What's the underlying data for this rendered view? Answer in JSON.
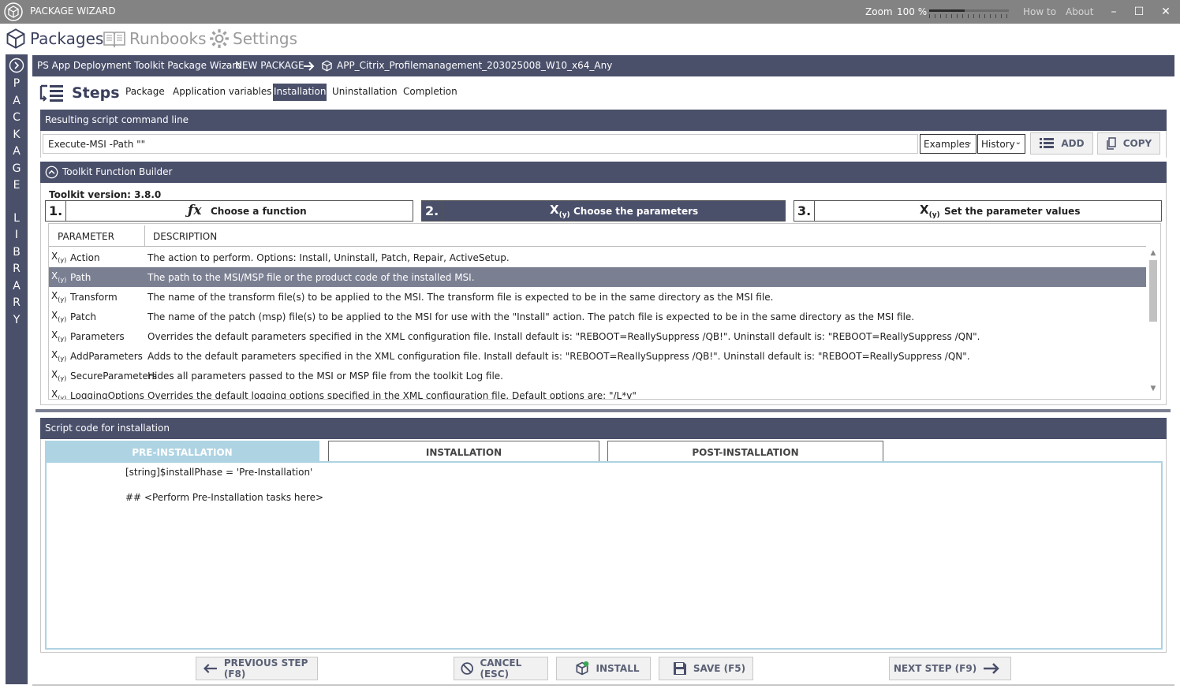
{
  "window": {
    "title": "PACKAGE WIZARD",
    "zoom_label": "Zoom",
    "zoom_value": "100 %",
    "zoom_fraction": 0.45,
    "how_to": "How to",
    "about": "About",
    "minimize": "–",
    "maximize": "☐",
    "close": "✕"
  },
  "nav": {
    "packages": "Packages",
    "runbooks": "Runbooks",
    "settings": "Settings"
  },
  "sidebar": {
    "letters": [
      "P",
      "A",
      "C",
      "K",
      "A",
      "G",
      "E",
      "L",
      "I",
      "B",
      "R",
      "A",
      "R",
      "Y"
    ]
  },
  "header": {
    "wizard_title": "PS App Deployment Toolkit Package Wizard",
    "separator": "-",
    "package_state": "NEW PACKAGE",
    "package_name": "APP_Citrix_Profilemanagement_203025008_W10_x64_Any"
  },
  "steps": {
    "title": "Steps",
    "tabs": [
      "Package",
      "Application variables",
      "Installation",
      "Uninstallation",
      "Completion"
    ],
    "active": "Installation"
  },
  "command": {
    "header": "Resulting script command line",
    "value": "Execute-MSI  -Path \"\"",
    "examples": "Examples",
    "history": "History",
    "add": "ADD",
    "copy": "COPY"
  },
  "builder": {
    "header": "Toolkit Function Builder",
    "toolkit_version": "Toolkit version:  3.8.0",
    "step1_num": "1.",
    "step1_label": "Choose a function",
    "step2_num": "2.",
    "step2_label": "Choose the parameters",
    "step3_num": "3.",
    "step3_label": "Set the parameter values",
    "col_parameter": "PARAMETER",
    "col_description": "DESCRIPTION",
    "rows": [
      {
        "name": "Action",
        "desc": "The action to perform. Options: Install, Uninstall, Patch, Repair, ActiveSetup."
      },
      {
        "name": "Path",
        "desc": "The path to the MSI/MSP file or the product code of the installed MSI."
      },
      {
        "name": "Transform",
        "desc": "The name of the transform file(s) to be applied to the MSI. The transform file is expected to be in the same directory as the MSI file."
      },
      {
        "name": "Patch",
        "desc": "The name of the patch (msp) file(s) to be applied to the MSI for use with the \"Install\" action. The patch file is expected to be in the same directory as the MSI file."
      },
      {
        "name": "Parameters",
        "desc": "Overrides the default parameters specified in the XML configuration file. Install default is: \"REBOOT=ReallySuppress /QB!\". Uninstall default is: \"REBOOT=ReallySuppress /QN\"."
      },
      {
        "name": "AddParameters",
        "desc": "Adds to the default parameters specified in the XML configuration file. Install default is: \"REBOOT=ReallySuppress /QB!\". Uninstall default is: \"REBOOT=ReallySuppress /QN\"."
      },
      {
        "name": "SecureParameters",
        "desc": "Hides all parameters passed to the MSI or MSP file from the toolkit Log file."
      },
      {
        "name": "LoggingOptions",
        "desc": "Overrides the default logging options specified in the XML configuration file. Default options are: \"/L*v\""
      }
    ]
  },
  "script": {
    "header": "Script code for installation",
    "tabs": [
      "PRE-INSTALLATION",
      "INSTALLATION",
      "POST-INSTALLATION"
    ],
    "active_tab": "PRE-INSTALLATION",
    "lines": [
      "[string]$installPhase = 'Pre-Installation'",
      "## <Perform Pre-Installation tasks here>"
    ]
  },
  "footer": {
    "previous": "PREVIOUS STEP (F8)",
    "cancel": "CANCEL (ESC)",
    "install": "INSTALL",
    "save": "SAVE (F5)",
    "next": "NEXT STEP (F9)"
  }
}
